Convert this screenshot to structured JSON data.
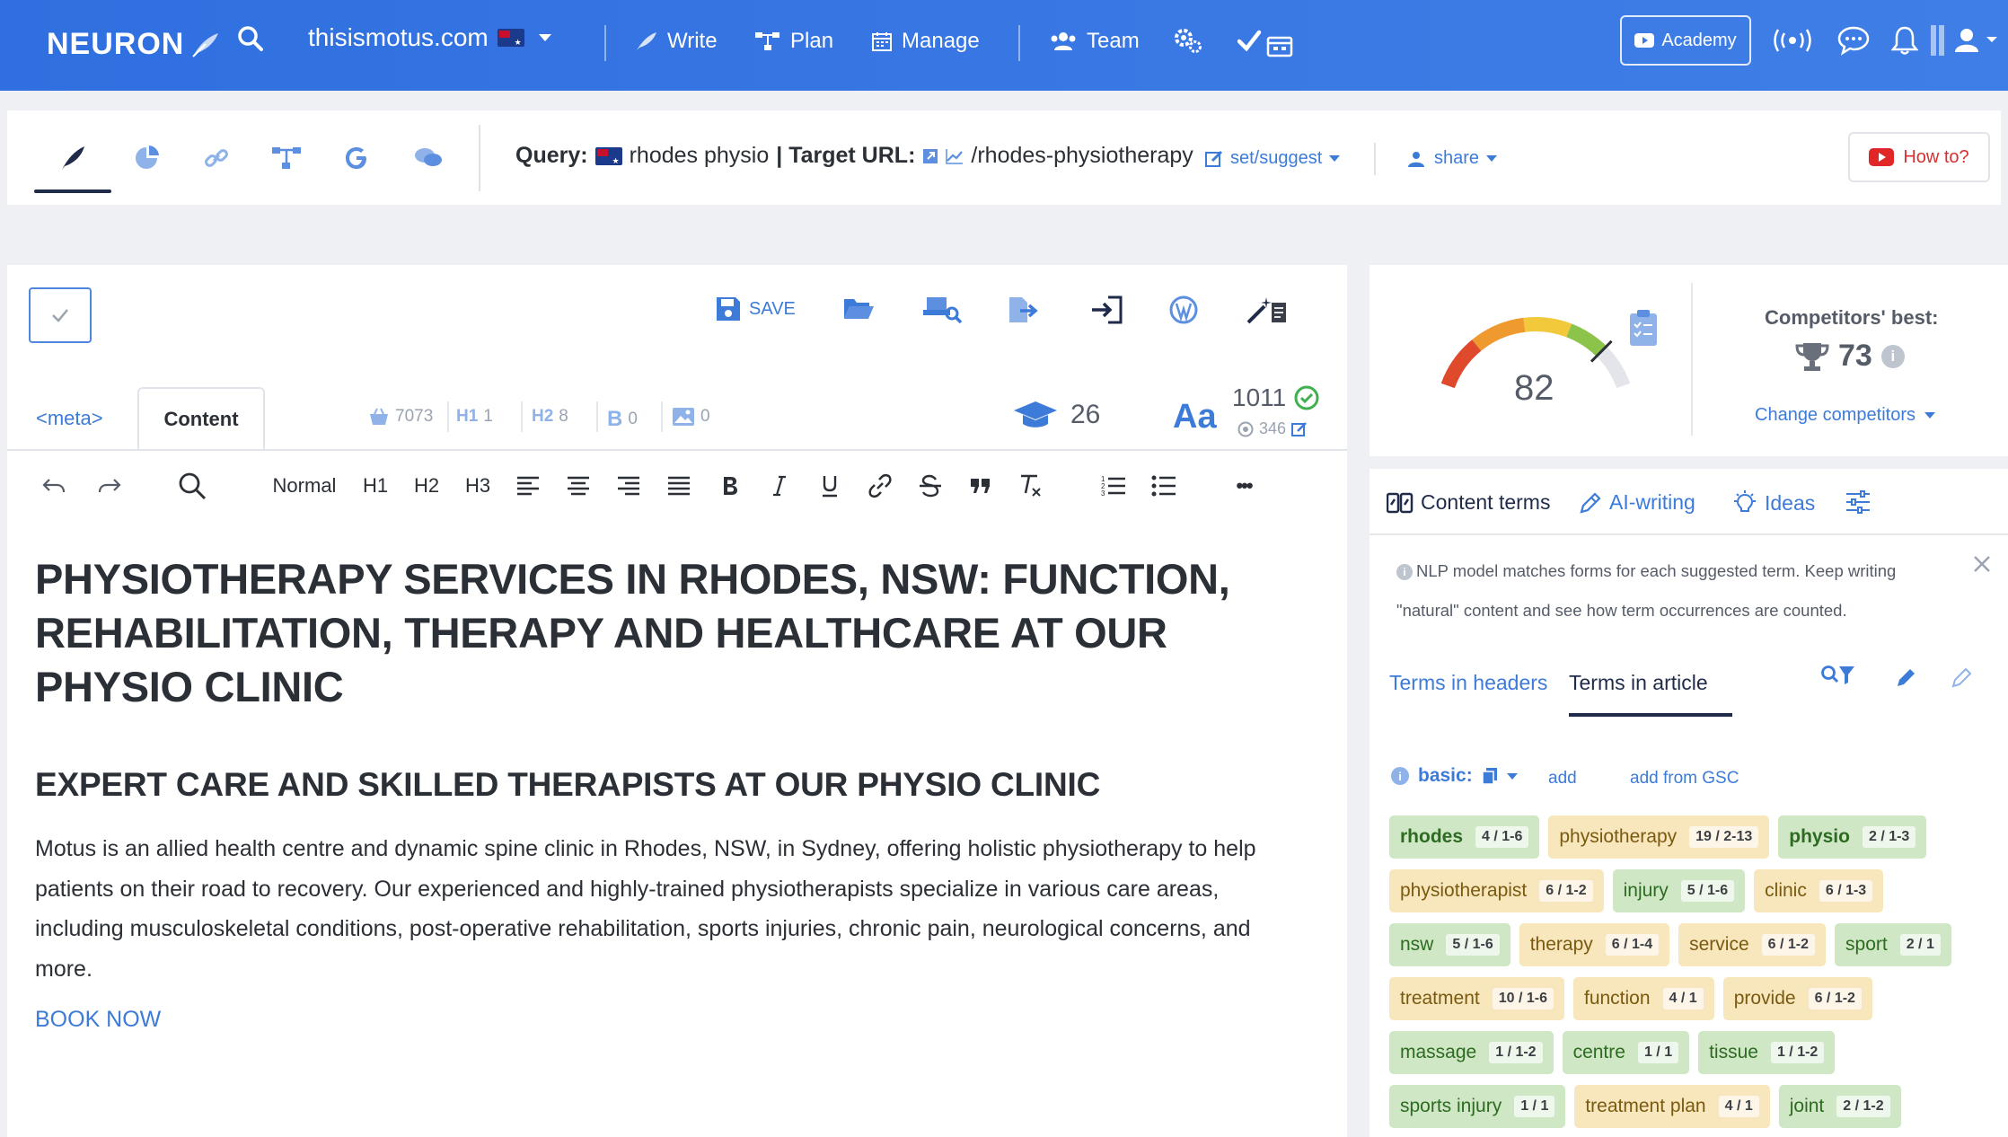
{
  "topnav": {
    "logo": "NEURON",
    "domain": "thisismotus.com",
    "items": [
      {
        "label": "Write"
      },
      {
        "label": "Plan"
      },
      {
        "label": "Manage"
      },
      {
        "label": "Team"
      }
    ],
    "academy": "Academy"
  },
  "subbar": {
    "query_label": "Query:",
    "query": "rhodes physio",
    "target_label": "| Target URL:",
    "target_url": "/rhodes-physiotherapy",
    "set_suggest": "set/suggest",
    "share": "share",
    "how_to": "How to?"
  },
  "editor": {
    "save": "SAVE",
    "tabs": {
      "meta": "<meta>",
      "content": "Content"
    },
    "stats": {
      "images_count": "7073",
      "h1_label": "H1",
      "h1": "1",
      "h2_label": "H2",
      "h2": "8",
      "b_label": "B",
      "b": "0",
      "img": "0"
    },
    "grade": "26",
    "font_icon": "Aa",
    "word_count": "1011",
    "word_target": "346",
    "format": {
      "style": "Normal",
      "h1": "H1",
      "h2": "H2",
      "h3": "H3",
      "more": "•••"
    },
    "document": {
      "h1": "PHYSIOTHERAPY SERVICES IN RHODES, NSW: FUNCTION, REHABILITATION, THERAPY AND HEALTHCARE AT OUR PHYSIO CLINIC",
      "h2": "EXPERT CARE AND SKILLED THERAPISTS AT OUR PHYSIO CLINIC",
      "paragraph": "Motus is an allied health centre and dynamic spine clinic in Rhodes, NSW, in Sydney, offering holistic physiotherapy to help patients on their road to recovery. Our experienced and highly-trained physiotherapists specialize in various care areas, including musculoskeletal conditions, post-operative rehabilitation, sports injuries, chronic pain, neurological concerns, and more.",
      "cta": "BOOK NOW"
    }
  },
  "score": {
    "value": 82,
    "competitors_title": "Competitors' best:",
    "competitors_best": "73",
    "change": "Change competitors"
  },
  "terms": {
    "tabs": [
      "Content terms",
      "AI-writing",
      "Ideas"
    ],
    "notice": "NLP model matches forms for each suggested term. Keep writing \"natural\" content and see how term occurrences are counted.",
    "sub_tabs": [
      "Terms in headers",
      "Terms in article"
    ],
    "basic": "basic:",
    "add": "add",
    "add_gsc": "add from GSC",
    "chips": [
      {
        "term": "rhodes",
        "count": "4 / 1-6",
        "color": "g"
      },
      {
        "term": "physiotherapy",
        "count": "19 / 2-13",
        "color": "y"
      },
      {
        "term": "physio",
        "count": "2 / 1-3",
        "color": "g"
      },
      {
        "term": "physiotherapist",
        "count": "6 / 1-2",
        "color": "y"
      },
      {
        "term": "injury",
        "count": "5 / 1-6",
        "color": "g"
      },
      {
        "term": "clinic",
        "count": "6 / 1-3",
        "color": "y"
      },
      {
        "term": "nsw",
        "count": "5 / 1-6",
        "color": "g"
      },
      {
        "term": "therapy",
        "count": "6 / 1-4",
        "color": "y"
      },
      {
        "term": "service",
        "count": "6 / 1-2",
        "color": "y"
      },
      {
        "term": "sport",
        "count": "2 / 1",
        "color": "g"
      },
      {
        "term": "treatment",
        "count": "10 / 1-6",
        "color": "y"
      },
      {
        "term": "function",
        "count": "4 / 1",
        "color": "y"
      },
      {
        "term": "provide",
        "count": "6 / 1-2",
        "color": "y"
      },
      {
        "term": "massage",
        "count": "1 / 1-2",
        "color": "g"
      },
      {
        "term": "centre",
        "count": "1 / 1",
        "color": "g"
      },
      {
        "term": "tissue",
        "count": "1 / 1-2",
        "color": "g"
      },
      {
        "term": "sports injury",
        "count": "1 / 1",
        "color": "g"
      },
      {
        "term": "treatment plan",
        "count": "4 / 1",
        "color": "y"
      },
      {
        "term": "joint",
        "count": "2 / 1-2",
        "color": "g"
      }
    ]
  }
}
